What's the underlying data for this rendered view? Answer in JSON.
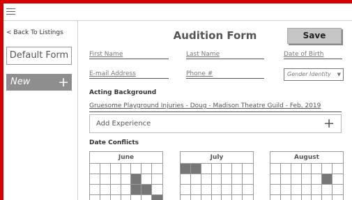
{
  "topbar": {
    "menu_icon": "hamburger-icon"
  },
  "sidebar": {
    "back_label": "< Back To Listings",
    "default_form_label": "Default Form",
    "new_label": "New",
    "new_icon": "plus-icon"
  },
  "form": {
    "title": "Audition Form",
    "save_label": "Save",
    "fields": {
      "first_name": "First Name",
      "last_name": "Last Name",
      "dob": "Date of Birth",
      "email": "E-mail Address",
      "phone": "Phone #",
      "gender": "Gender Identity"
    },
    "acting_background_label": "Acting Background",
    "experience_entry": "Gruesome Playground Injuries - Doug - Madison Theatre Guild - Feb. 2019",
    "add_experience_label": "Add Experience",
    "date_conflicts_label": "Date Conflicts",
    "calendars": [
      {
        "name": "June",
        "busy_cells": [
          11,
          18,
          19,
          27
        ]
      },
      {
        "name": "July",
        "busy_cells": [
          0,
          1
        ]
      },
      {
        "name": "August",
        "busy_cells": [
          12
        ]
      }
    ]
  },
  "colors": {
    "frame": "#d50000",
    "busy": "#777777",
    "button": "#c6c6c6"
  }
}
